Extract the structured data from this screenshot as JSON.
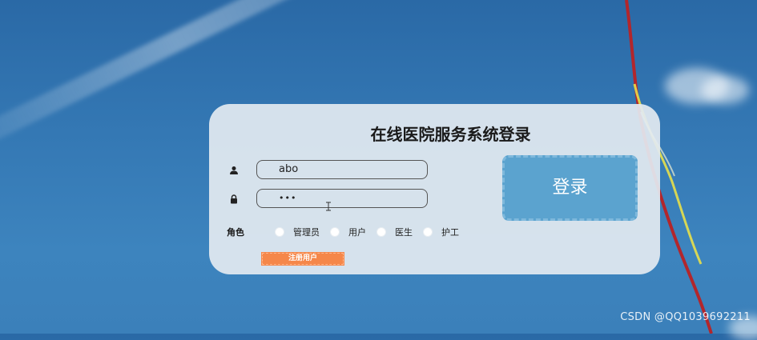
{
  "login": {
    "title": "在线医院服务系统登录",
    "username": {
      "icon": "user-icon",
      "value": "abo"
    },
    "password": {
      "icon": "lock-icon",
      "masked_value": "•••"
    },
    "role": {
      "label": "角色",
      "options": [
        "管理员",
        "用户",
        "医生",
        "护工"
      ]
    },
    "register_label": "注册用户",
    "submit_label": "登录"
  },
  "watermark": "CSDN @QQ1039692211",
  "colors": {
    "card_bg": "#e2eaf0",
    "login_button": "#5ba3cf",
    "register_button": "#f5874a",
    "sky": "#3478b4"
  }
}
